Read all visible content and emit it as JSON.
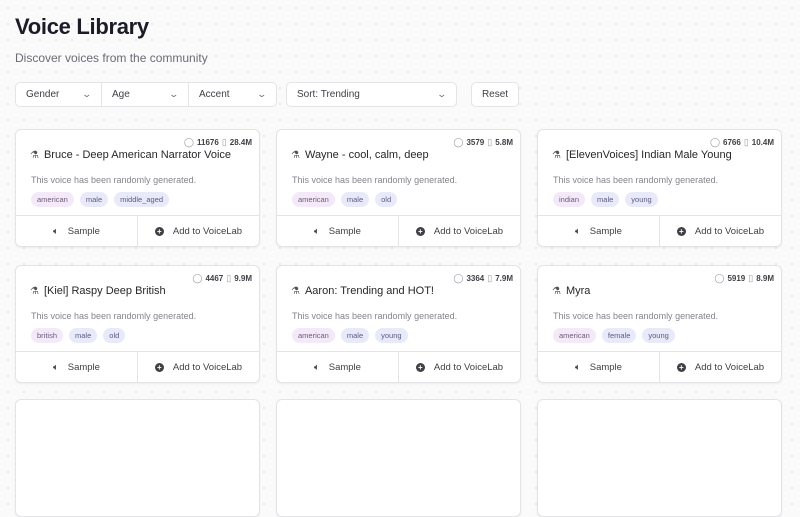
{
  "header": {
    "title": "Voice Library",
    "subtitle": "Discover voices from the community"
  },
  "filters": {
    "gender": "Gender",
    "age": "Age",
    "accent": "Accent",
    "sort": "Sort: Trending",
    "reset": "Reset"
  },
  "card_common": {
    "description": "This voice has been randomly generated.",
    "sample_label": "Sample",
    "add_label": "Add to VoiceLab"
  },
  "voices": [
    {
      "name": "Bruce - Deep American Narrator Voice",
      "users": "11676",
      "size": "28.4M",
      "tags": [
        "american",
        "male",
        "middle_aged"
      ]
    },
    {
      "name": "Wayne - cool, calm, deep",
      "users": "3579",
      "size": "5.8M",
      "tags": [
        "american",
        "male",
        "old"
      ]
    },
    {
      "name": "[ElevenVoices] Indian Male Young",
      "users": "6766",
      "size": "10.4M",
      "tags": [
        "indian",
        "male",
        "young"
      ]
    },
    {
      "name": "[Kiel] Raspy Deep British",
      "users": "4467",
      "size": "9.9M",
      "tags": [
        "british",
        "male",
        "old"
      ]
    },
    {
      "name": "Aaron: Trending and HOT!",
      "users": "3364",
      "size": "7.9M",
      "tags": [
        "american",
        "male",
        "young"
      ]
    },
    {
      "name": "Myra",
      "users": "5919",
      "size": "8.9M",
      "tags": [
        "american",
        "female",
        "young"
      ]
    }
  ]
}
